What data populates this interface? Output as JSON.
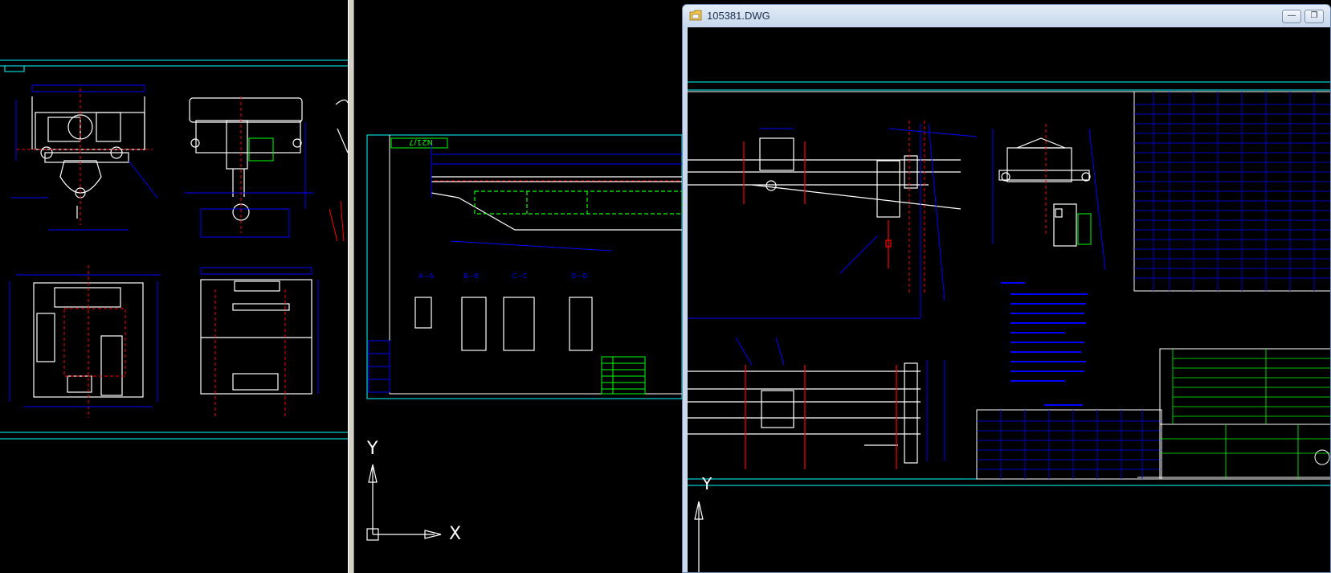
{
  "right_window": {
    "title": "105381.DWG",
    "minimize_glyph": "—",
    "restore_glyph": "❐",
    "icon": "dwg-file-icon"
  },
  "mid_window": {
    "ucs_x": "X",
    "ucs_y": "Y",
    "frame_tag": "N21/7",
    "section_labels": [
      "A—A",
      "B—B",
      "C—C",
      "D—D"
    ]
  },
  "right_canvas": {
    "ucs_y": "Y"
  },
  "colors": {
    "background": "#000000",
    "line_white": "#ffffff",
    "line_cyan": "#00ffff",
    "line_blue": "#0000ff",
    "line_red": "#ff0000",
    "line_green": "#00ff00",
    "window_border": "#6d8bb3"
  }
}
